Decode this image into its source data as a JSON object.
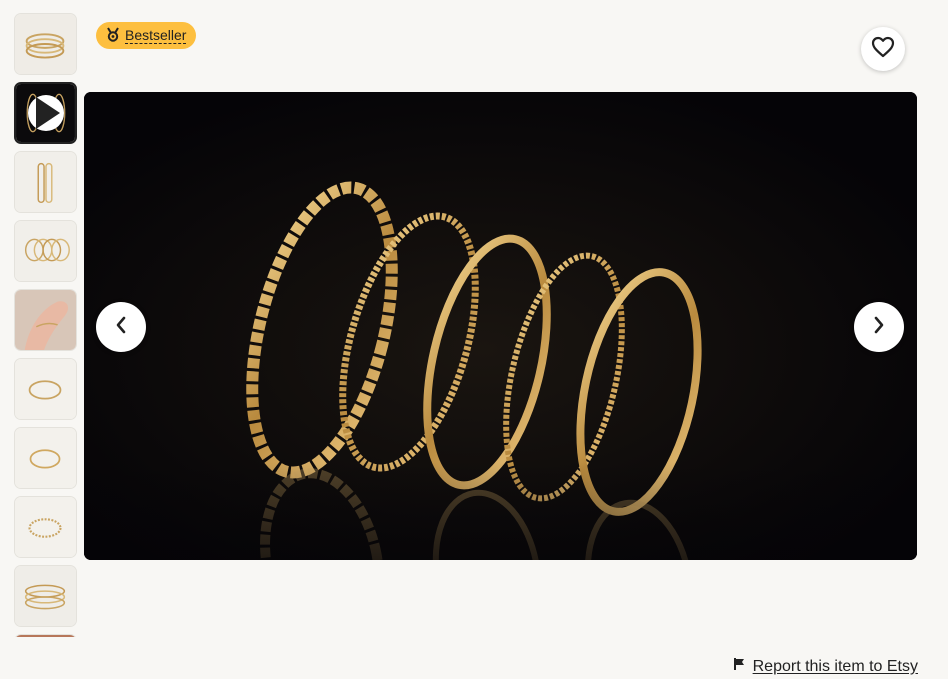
{
  "badge": {
    "label": "Bestseller",
    "icon": "medal-icon",
    "color": "#fdbf3f"
  },
  "favorite": {
    "icon": "heart-outline-icon"
  },
  "thumbnails": [
    {
      "name": "thumbnail-ring-stack",
      "kind": "image"
    },
    {
      "name": "thumbnail-video",
      "kind": "video",
      "icon": "play-icon"
    },
    {
      "name": "thumbnail-rings-vertical",
      "kind": "image"
    },
    {
      "name": "thumbnail-rings-fanned",
      "kind": "image"
    },
    {
      "name": "thumbnail-hand-wearing",
      "kind": "image"
    },
    {
      "name": "thumbnail-single-ring",
      "kind": "image"
    },
    {
      "name": "thumbnail-single-ring-2",
      "kind": "image"
    },
    {
      "name": "thumbnail-beaded-ring",
      "kind": "image"
    },
    {
      "name": "thumbnail-ring-set",
      "kind": "image"
    },
    {
      "name": "thumbnail-partial",
      "kind": "image"
    }
  ],
  "viewer": {
    "prev_icon": "chevron-left-icon",
    "next_icon": "chevron-right-icon",
    "background": "#050407",
    "ring_color": "#d7ad5e"
  },
  "report": {
    "label": "Report this item to Etsy",
    "icon": "flag-icon"
  }
}
